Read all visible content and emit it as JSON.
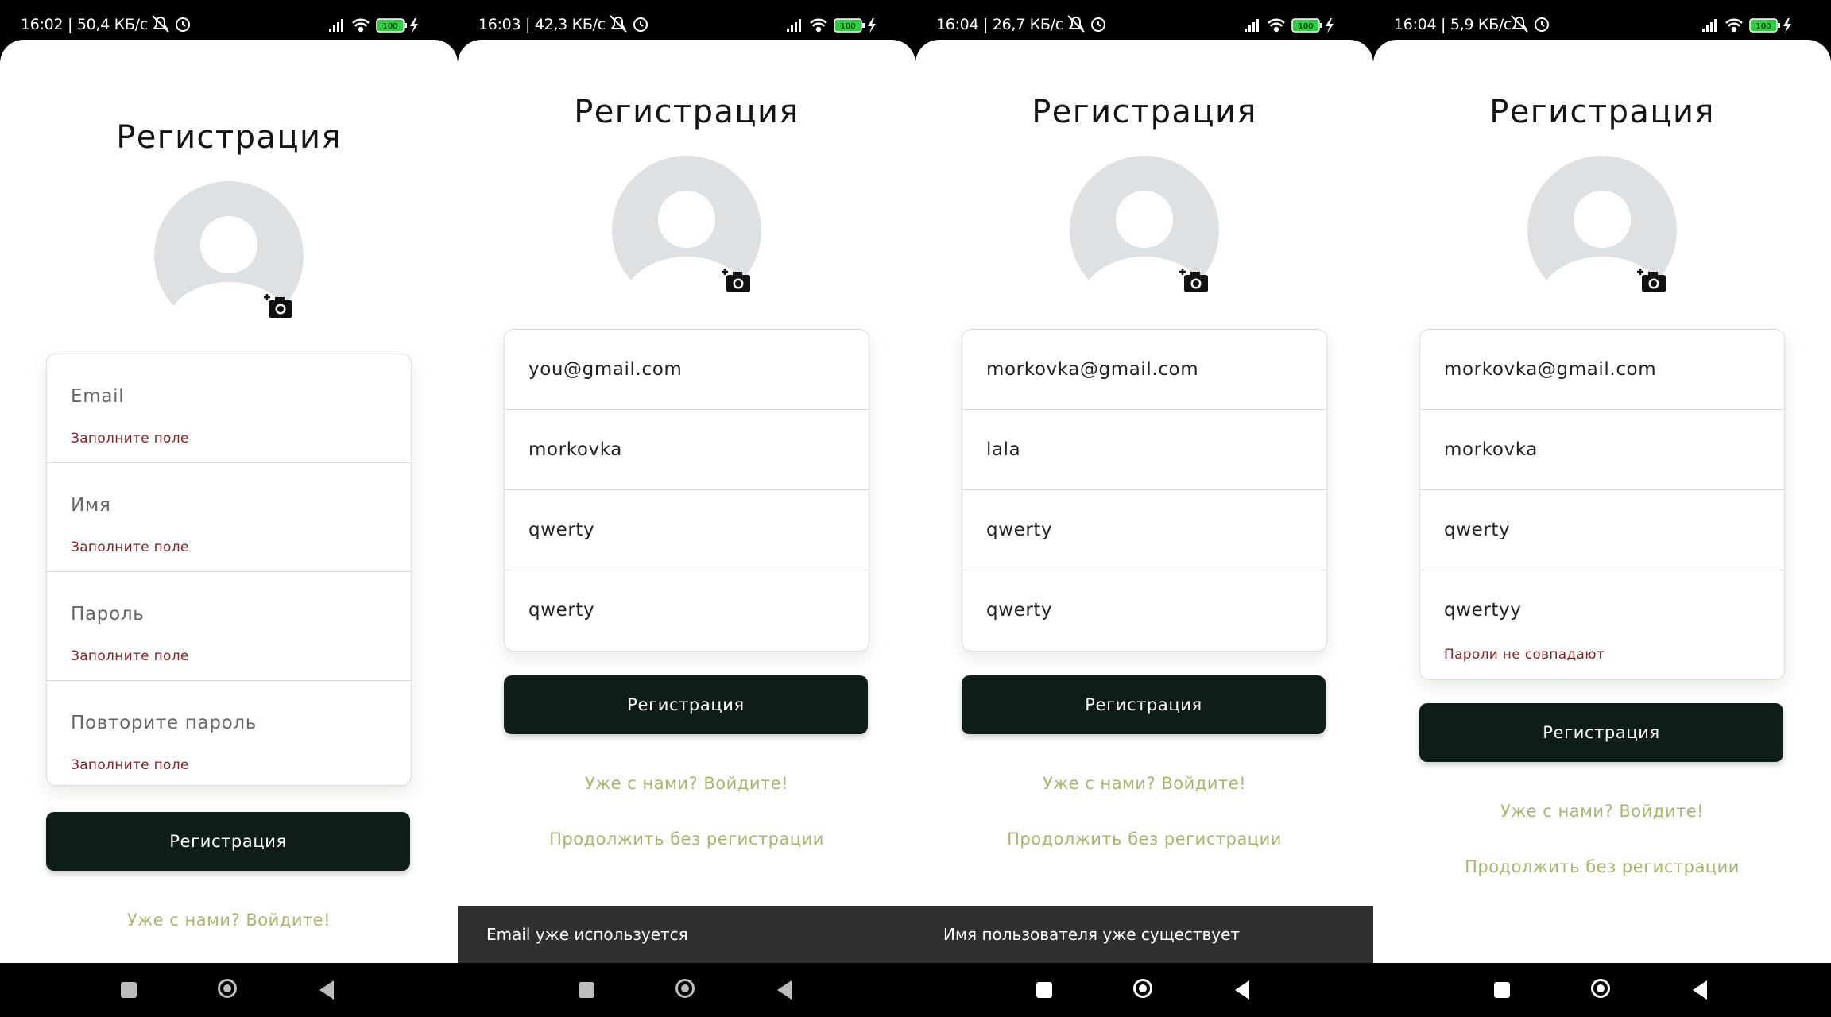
{
  "status_icons": [
    "signal-icon",
    "wifi-icon",
    "battery-icon",
    "charging-icon",
    "mute-icon",
    "alarm-icon"
  ],
  "colors": {
    "button_bg": "#0f1d1a",
    "link": "#a2b96c",
    "error": "#8b1e1e",
    "snackbar_bg": "#303030",
    "avatar_bg": "#dde1e4"
  },
  "panels": [
    {
      "status_text": "16:02 | 50,4 КБ/с",
      "battery": "100",
      "title": "Регистрация",
      "fields": [
        {
          "placeholder": "Email",
          "error": "Заполните поле"
        },
        {
          "placeholder": "Имя",
          "error": "Заполните поле"
        },
        {
          "placeholder": "Пароль",
          "error": "Заполните поле"
        },
        {
          "placeholder": "Повторите пароль",
          "error": "Заполните поле"
        }
      ],
      "button": "Регистрация",
      "login_link": "Уже с нами? Войдите!"
    },
    {
      "status_text": "16:03 | 42,3 КБ/с",
      "battery": "100",
      "title": "Регистрация",
      "fields": [
        {
          "value": "you@gmail.com"
        },
        {
          "value": "morkovka"
        },
        {
          "value": "qwerty"
        },
        {
          "value": "qwerty"
        }
      ],
      "button": "Регистрация",
      "login_link": "Уже с нами? Войдите!",
      "guest_link": "Продолжить без регистрации",
      "snackbar": "Email уже используется"
    },
    {
      "status_text": "16:04 | 26,7 КБ/с",
      "battery": "100",
      "title": "Регистрация",
      "fields": [
        {
          "value": "morkovka@gmail.com"
        },
        {
          "value": "lala"
        },
        {
          "value": "qwerty"
        },
        {
          "value": "qwerty"
        }
      ],
      "button": "Регистрация",
      "login_link": "Уже с нами? Войдите!",
      "guest_link": "Продолжить без регистрации",
      "snackbar": "Имя пользователя уже существует"
    },
    {
      "status_text": "16:04 | 5,9 КБ/с",
      "battery": "100",
      "title": "Регистрация",
      "fields": [
        {
          "value": "morkovka@gmail.com"
        },
        {
          "value": "morkovka"
        },
        {
          "value": "qwerty"
        },
        {
          "value": "qwertyy",
          "error": "Пароли не совпадают"
        }
      ],
      "button": "Регистрация",
      "login_link": "Уже с нами? Войдите!",
      "guest_link": "Продолжить без регистрации"
    }
  ]
}
